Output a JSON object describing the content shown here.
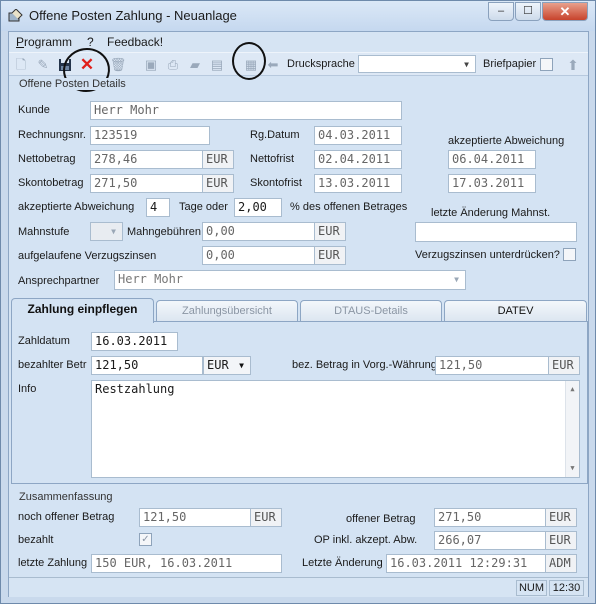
{
  "window": {
    "title": "Offene Posten Zahlung - Neuanlage",
    "min_glyph": "–",
    "max_glyph": "☐",
    "close_glyph": "✕"
  },
  "menu": {
    "items": [
      "Programm",
      "?",
      "Feedback!"
    ]
  },
  "toolbar": {
    "druck_label": "Drucksprache",
    "druck_value": "",
    "brief_label": "Briefpapier"
  },
  "details": {
    "group_title": "Offene Posten Details",
    "kunde_label": "Kunde",
    "kunde_value": "Herr Mohr",
    "rechnung_label": "Rechnungsnr.",
    "rechnung_value": "123519",
    "rgdatum_label": "Rg.Datum",
    "rgdatum_value": "04.03.2011",
    "netto_label": "Nettobetrag",
    "netto_value": "278,46",
    "netto_unit": "EUR",
    "nettofrist_label": "Nettofrist",
    "nettofrist_value": "02.04.2011",
    "skonto_label": "Skontobetrag",
    "skonto_value": "271,50",
    "skonto_unit": "EUR",
    "skontofrist_label": "Skontofrist",
    "skontofrist_value": "13.03.2011",
    "akz_abw_label": "akzeptierte Abweichung",
    "akz_abw1": "06.04.2011",
    "akz_abw2": "17.03.2011",
    "akz_label": "akzeptierte Abweichung",
    "akz_tage": "4",
    "tage_oder": "Tage oder",
    "akz_pct": "2,00",
    "pct_label": "% des offenen Betrages",
    "letzte_mahn_label": "letzte Änderung Mahnst.",
    "letzte_mahn_value": "",
    "mahnstufe_label": "Mahnstufe",
    "mahngeb_label": "Mahngebühren",
    "mahngeb_value": "0,00",
    "mahngeb_unit": "EUR",
    "verzug_label": "aufgelaufene Verzugszinsen",
    "verzug_value": "0,00",
    "verzug_unit": "EUR",
    "verzug_unterdr_label": "Verzugszinsen unterdrücken?",
    "ansprech_label": "Ansprechpartner",
    "ansprech_value": "Herr Mohr"
  },
  "tabs": [
    "Zahlung einpflegen",
    "Zahlungsübersicht",
    "DTAUS-Details",
    "DATEV"
  ],
  "zahlung": {
    "datum_label": "Zahldatum",
    "datum_value": "16.03.2011",
    "betrag_label": "bezahlter Betr",
    "betrag_value": "121,50",
    "currency": "EUR",
    "vorg_label": "bez. Betrag in Vorg.-Währung",
    "vorg_value": "121,50",
    "vorg_unit": "EUR",
    "info_label": "Info",
    "info_value": "Restzahlung"
  },
  "summary": {
    "group_title": "Zusammenfassung",
    "noch_label": "noch offener Betrag",
    "noch_value": "121,50",
    "noch_unit": "EUR",
    "offen_label": "offener Betrag",
    "offen_value": "271,50",
    "offen_unit": "EUR",
    "bezahlt_label": "bezahlt",
    "op_label": "OP inkl. akzept. Abw.",
    "op_value": "266,07",
    "op_unit": "EUR",
    "letzte_label": "letzte Zahlung",
    "letzte_value": "150 EUR, 16.03.2011",
    "aend_label": "Letzte Änderung",
    "aend_value": "16.03.2011 12:29:31",
    "aend_user": "ADM"
  },
  "status": {
    "num": "NUM",
    "time": "12:30"
  }
}
